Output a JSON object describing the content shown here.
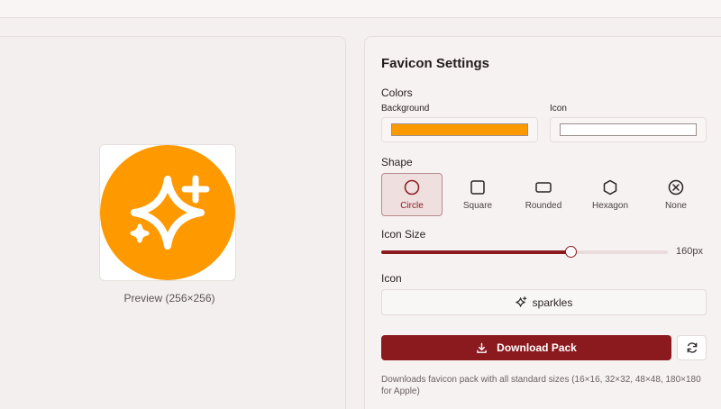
{
  "preview": {
    "caption": "Preview (256×256)",
    "background_color": "#FF9900",
    "icon_color": "#FFFFFF",
    "icon": "sparkles-icon"
  },
  "settings": {
    "title": "Favicon Settings",
    "colors": {
      "label": "Colors",
      "background_label": "Background",
      "background_value": "#FF9900",
      "icon_label": "Icon",
      "icon_value": "#FFFFFF"
    },
    "shape": {
      "label": "Shape",
      "selected": "Circle",
      "options": [
        {
          "label": "Circle",
          "icon": "circle-icon"
        },
        {
          "label": "Square",
          "icon": "square-icon"
        },
        {
          "label": "Rounded",
          "icon": "rounded-rect-icon"
        },
        {
          "label": "Hexagon",
          "icon": "hexagon-icon"
        },
        {
          "label": "None",
          "icon": "none-icon"
        }
      ]
    },
    "icon_size": {
      "label": "Icon Size",
      "value_text": "160px",
      "fraction": 0.66
    },
    "icon_picker": {
      "label": "Icon",
      "value": "sparkles",
      "icon": "sparkles-icon"
    },
    "download": {
      "label": "Download Pack",
      "icon": "download-icon",
      "refresh_icon": "refresh-icon",
      "help": "Downloads favicon pack with all standard sizes (16×16, 32×32, 48×48, 180×180 for Apple)"
    },
    "accent_color": "#8B1A1F"
  }
}
